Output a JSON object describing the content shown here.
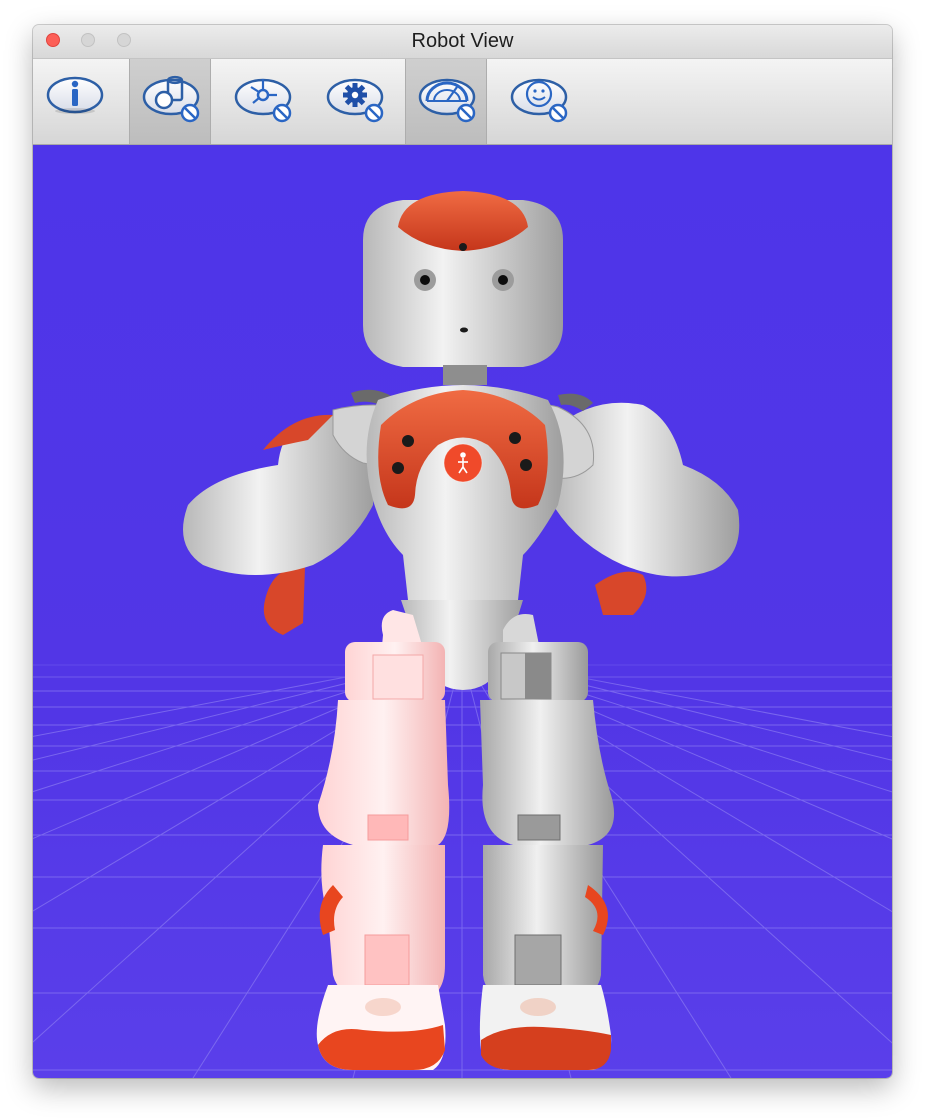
{
  "window": {
    "title": "Robot View"
  },
  "toolbar": {
    "buttons": [
      {
        "name": "info",
        "icon": "info-icon",
        "active": false
      },
      {
        "name": "collision-shapes",
        "icon": "shapes-disabled-icon",
        "active": true
      },
      {
        "name": "joints",
        "icon": "joint-axes-disabled-icon",
        "active": false
      },
      {
        "name": "sensors",
        "icon": "gear-disabled-icon",
        "active": false
      },
      {
        "name": "field-of-view",
        "icon": "fov-disabled-icon",
        "active": true
      },
      {
        "name": "face-detection",
        "icon": "smiley-disabled-icon",
        "active": false
      }
    ]
  },
  "scene": {
    "background_color": "#5236e6",
    "grid_color": "#8a7af2",
    "robot_accent_color": "#e8461f",
    "robot_body_color": "#dcdcdc",
    "highlight_color": "#ffc8c8"
  }
}
